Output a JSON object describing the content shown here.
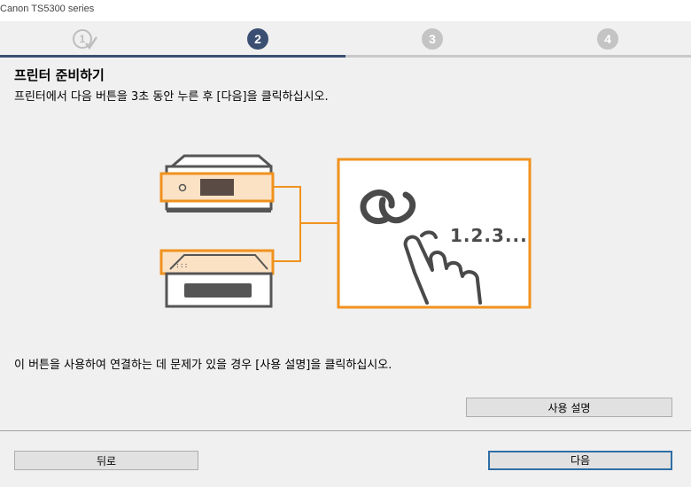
{
  "window": {
    "title": "Canon TS5300 series"
  },
  "steps": [
    {
      "label": "1",
      "state": "done"
    },
    {
      "label": "2",
      "state": "current"
    },
    {
      "label": "3",
      "state": "pending"
    },
    {
      "label": "4",
      "state": "pending"
    }
  ],
  "main": {
    "heading": "프린터 준비하기",
    "instruction": "프린터에서 다음 버튼을 3초 동안 누른 후 [다음]을 클릭하십시오.",
    "illustration": {
      "press_label": "1.2.3..."
    },
    "note": "이 버튼을 사용하여 연결하는 데 문제가 있을 경우 [사용 설명]을 클릭하십시오."
  },
  "buttons": {
    "help": "사용 설명",
    "back": "뒤로",
    "next": "다음"
  },
  "colors": {
    "accent": "#3a4f72",
    "highlight": "#f0921e",
    "pending": "#c4c4c4"
  }
}
